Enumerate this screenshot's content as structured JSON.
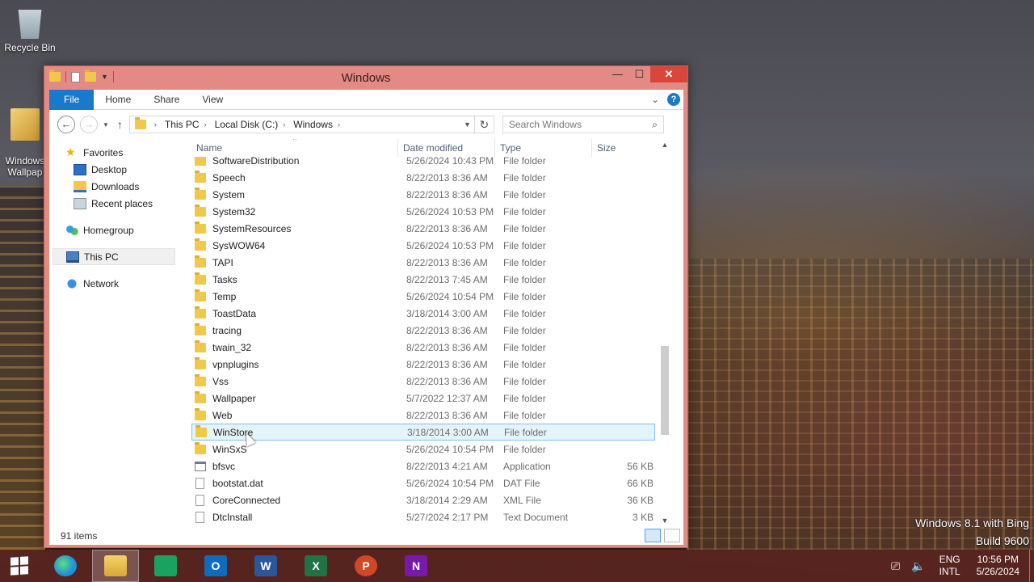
{
  "desktop": {
    "icons": [
      {
        "label": "Recycle Bin",
        "icon": "recycle-bin-icon"
      },
      {
        "label": "Windows\nWallpap",
        "icon": "wallpaper-folder-icon"
      }
    ],
    "watermark_line1": "Windows 8.1 with Bing",
    "watermark_line2": "Build 9600"
  },
  "window": {
    "title": "Windows",
    "buttons": {
      "minimize": "—",
      "maximize": "☐",
      "close": "✕"
    }
  },
  "ribbon": {
    "tabs": [
      "File",
      "Home",
      "Share",
      "View"
    ],
    "help": "?"
  },
  "address": {
    "crumbs": [
      "This PC",
      "Local Disk (C:)",
      "Windows"
    ],
    "search_placeholder": "Search Windows"
  },
  "nav_pane": {
    "favorites": "Favorites",
    "desktop": "Desktop",
    "downloads": "Downloads",
    "recent": "Recent places",
    "homegroup": "Homegroup",
    "this_pc": "This PC",
    "network": "Network"
  },
  "columns": {
    "name": "Name",
    "date": "Date modified",
    "type": "Type",
    "size": "Size"
  },
  "files": [
    {
      "name": "SoftwareDistribution",
      "date": "5/26/2024 10:43 PM",
      "type": "File folder",
      "size": "",
      "kind": "folder"
    },
    {
      "name": "Speech",
      "date": "8/22/2013 8:36 AM",
      "type": "File folder",
      "size": "",
      "kind": "folder"
    },
    {
      "name": "System",
      "date": "8/22/2013 8:36 AM",
      "type": "File folder",
      "size": "",
      "kind": "folder"
    },
    {
      "name": "System32",
      "date": "5/26/2024 10:53 PM",
      "type": "File folder",
      "size": "",
      "kind": "folder"
    },
    {
      "name": "SystemResources",
      "date": "8/22/2013 8:36 AM",
      "type": "File folder",
      "size": "",
      "kind": "folder"
    },
    {
      "name": "SysWOW64",
      "date": "5/26/2024 10:53 PM",
      "type": "File folder",
      "size": "",
      "kind": "folder"
    },
    {
      "name": "TAPI",
      "date": "8/22/2013 8:36 AM",
      "type": "File folder",
      "size": "",
      "kind": "folder"
    },
    {
      "name": "Tasks",
      "date": "8/22/2013 7:45 AM",
      "type": "File folder",
      "size": "",
      "kind": "folder"
    },
    {
      "name": "Temp",
      "date": "5/26/2024 10:54 PM",
      "type": "File folder",
      "size": "",
      "kind": "folder"
    },
    {
      "name": "ToastData",
      "date": "3/18/2014 3:00 AM",
      "type": "File folder",
      "size": "",
      "kind": "folder"
    },
    {
      "name": "tracing",
      "date": "8/22/2013 8:36 AM",
      "type": "File folder",
      "size": "",
      "kind": "folder"
    },
    {
      "name": "twain_32",
      "date": "8/22/2013 8:36 AM",
      "type": "File folder",
      "size": "",
      "kind": "folder"
    },
    {
      "name": "vpnplugins",
      "date": "8/22/2013 8:36 AM",
      "type": "File folder",
      "size": "",
      "kind": "folder"
    },
    {
      "name": "Vss",
      "date": "8/22/2013 8:36 AM",
      "type": "File folder",
      "size": "",
      "kind": "folder"
    },
    {
      "name": "Wallpaper",
      "date": "5/7/2022 12:37 AM",
      "type": "File folder",
      "size": "",
      "kind": "folder"
    },
    {
      "name": "Web",
      "date": "8/22/2013 8:36 AM",
      "type": "File folder",
      "size": "",
      "kind": "folder"
    },
    {
      "name": "WinStore",
      "date": "3/18/2014 3:00 AM",
      "type": "File folder",
      "size": "",
      "kind": "folder",
      "selected": true
    },
    {
      "name": "WinSxS",
      "date": "5/26/2024 10:54 PM",
      "type": "File folder",
      "size": "",
      "kind": "folder"
    },
    {
      "name": "bfsvc",
      "date": "8/22/2013 4:21 AM",
      "type": "Application",
      "size": "56 KB",
      "kind": "app"
    },
    {
      "name": "bootstat.dat",
      "date": "5/26/2024 10:54 PM",
      "type": "DAT File",
      "size": "66 KB",
      "kind": "doc"
    },
    {
      "name": "CoreConnected",
      "date": "3/18/2014 2:29 AM",
      "type": "XML File",
      "size": "36 KB",
      "kind": "doc"
    },
    {
      "name": "DtcInstall",
      "date": "5/27/2024 2:17 PM",
      "type": "Text Document",
      "size": "3 KB",
      "kind": "doc"
    }
  ],
  "status": {
    "item_count": "91 items"
  },
  "taskbar": {
    "apps": [
      {
        "name": "edge",
        "label": ""
      },
      {
        "name": "explorer",
        "label": ""
      },
      {
        "name": "sheets",
        "label": ""
      },
      {
        "name": "outlook",
        "label": "O"
      },
      {
        "name": "word",
        "label": "W"
      },
      {
        "name": "excel",
        "label": "X"
      },
      {
        "name": "powerpoint",
        "label": "P"
      },
      {
        "name": "onenote",
        "label": "N"
      }
    ],
    "lang_top": "ENG",
    "lang_bottom": "INTL",
    "time": "10:56 PM",
    "date": "5/26/2024"
  },
  "colors": {
    "accent": "#1979ca",
    "title_bar": "#e48a84",
    "close": "#d9463c",
    "selection": "#e5f3fb"
  }
}
